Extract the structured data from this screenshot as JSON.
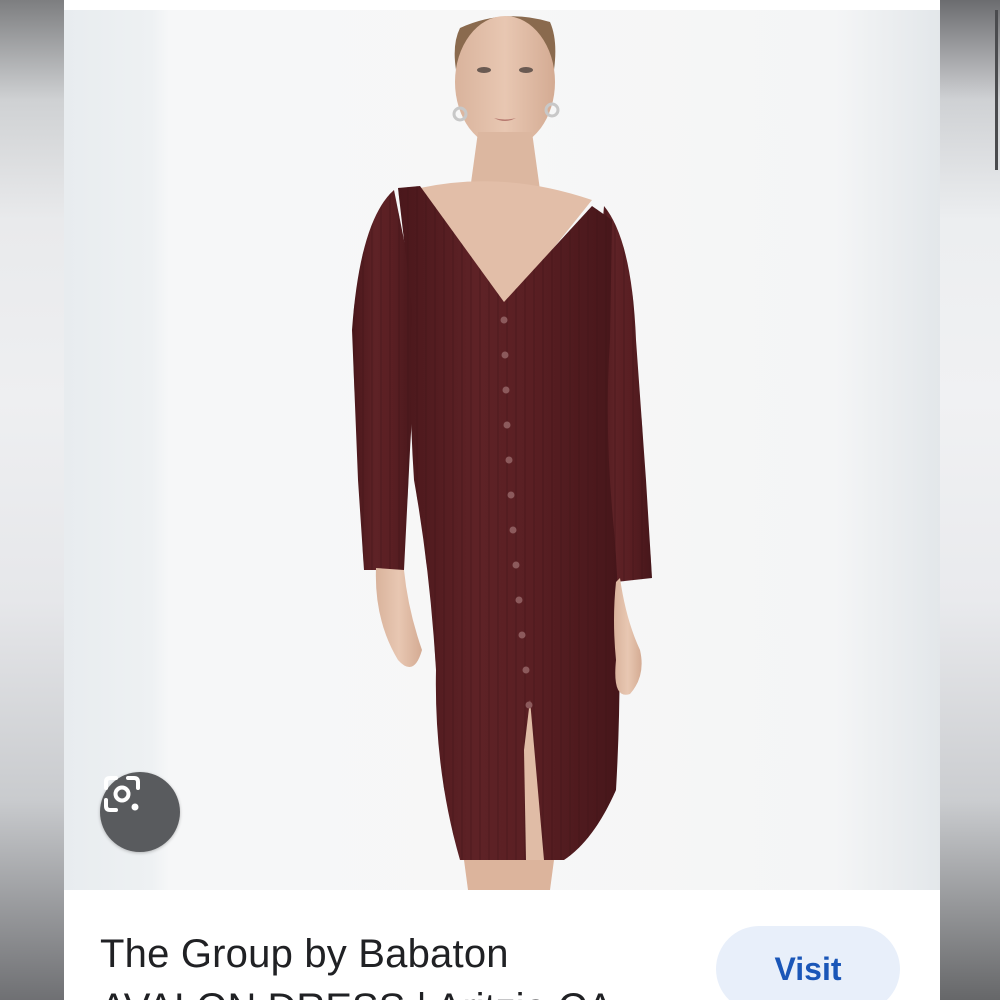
{
  "result_card": {
    "title": "The Group by Babaton",
    "subtitle": "AVALON DRESS | Aritzia CA",
    "visit_label": "Visit"
  },
  "image": {
    "description_icon": "model-wearing-dress",
    "dress_color": "#5a1f22"
  },
  "lens": {
    "icon": "lens-search-icon"
  },
  "colors": {
    "visit_button_bg": "#e8effa",
    "visit_button_text": "#1a56b8",
    "lens_button_bg": "#595b5e"
  }
}
